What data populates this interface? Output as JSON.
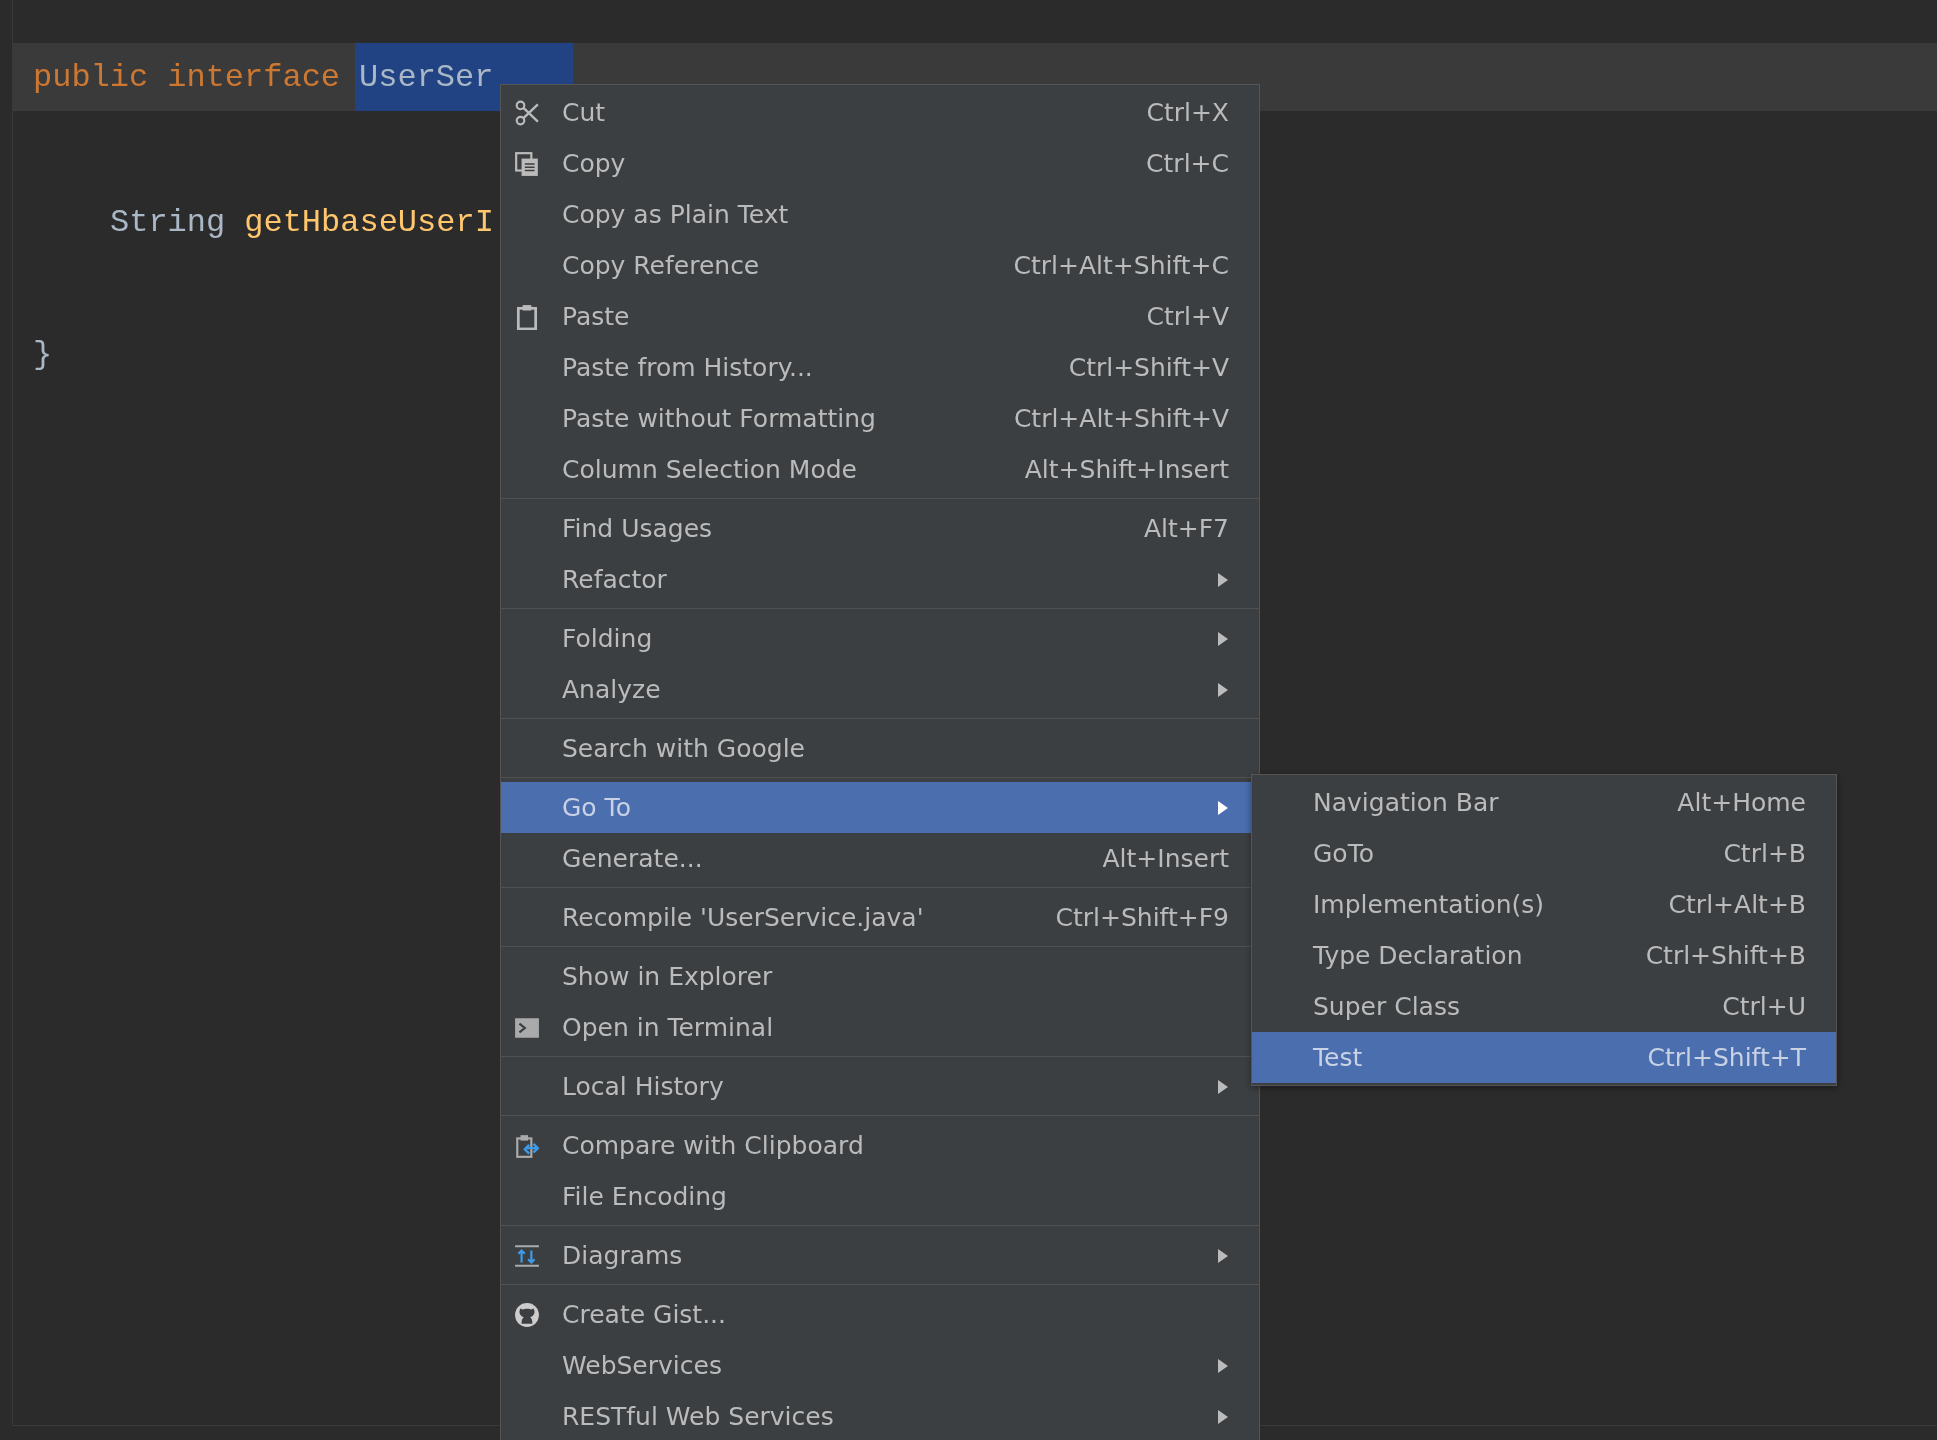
{
  "editor": {
    "lines": [
      {
        "current": true,
        "tokens": [
          {
            "text": "public",
            "kind": "keyword"
          },
          {
            "text": "interface",
            "kind": "keyword"
          },
          {
            "text": "UserSer",
            "kind": "plain",
            "selected": true
          }
        ],
        "children": [
          {
            "current": false,
            "tokens": [
              {
                "text": "String",
                "kind": "plain"
              },
              {
                "text": "getHbaseUserI",
                "kind": "method"
              }
            ]
          }
        ]
      },
      {
        "current": false,
        "tokens": [
          {
            "text": "}",
            "kind": "plain"
          }
        ]
      }
    ]
  },
  "context_menu": {
    "groups": [
      {
        "items": [
          {
            "label": "Cut",
            "shortcut": "Ctrl+X",
            "kind": "scissors",
            "selected": false
          },
          {
            "label": "Copy",
            "shortcut": "Ctrl+C",
            "kind": "copy",
            "selected": false
          },
          {
            "label": "Copy as Plain Text",
            "selected": false
          },
          {
            "label": "Copy Reference",
            "shortcut": "Ctrl+Alt+Shift+C",
            "selected": false
          },
          {
            "label": "Paste",
            "shortcut": "Ctrl+V",
            "kind": "clipboard",
            "selected": false
          },
          {
            "label": "Paste from History...",
            "shortcut": "Ctrl+Shift+V",
            "selected": false
          },
          {
            "label": "Paste without Formatting",
            "shortcut": "Ctrl+Alt+Shift+V",
            "selected": false
          },
          {
            "label": "Column Selection Mode",
            "shortcut": "Alt+Shift+Insert",
            "selected": false
          }
        ]
      },
      {
        "items": [
          {
            "label": "Find Usages",
            "shortcut": "Alt+F7",
            "selected": false
          },
          {
            "label": "Refactor",
            "has_submenu": true,
            "selected": false
          }
        ]
      },
      {
        "items": [
          {
            "label": "Folding",
            "has_submenu": true,
            "selected": false
          },
          {
            "label": "Analyze",
            "has_submenu": true,
            "selected": false
          }
        ]
      },
      {
        "items": [
          {
            "label": "Search with Google",
            "selected": false
          }
        ]
      },
      {
        "items": [
          {
            "label": "Go To",
            "has_submenu": true,
            "selected": true
          },
          {
            "label": "Generate...",
            "shortcut": "Alt+Insert",
            "selected": false
          }
        ]
      },
      {
        "items": [
          {
            "label": "Recompile 'UserService.java'",
            "shortcut": "Ctrl+Shift+F9",
            "selected": false
          }
        ]
      },
      {
        "items": [
          {
            "label": "Show in Explorer",
            "selected": false
          },
          {
            "label": "Open in Terminal",
            "kind": "terminal",
            "selected": false
          }
        ]
      },
      {
        "items": [
          {
            "label": "Local History",
            "has_submenu": true,
            "selected": false
          }
        ]
      },
      {
        "items": [
          {
            "label": "Compare with Clipboard",
            "kind": "compare",
            "selected": false
          },
          {
            "label": "File Encoding",
            "selected": false
          }
        ]
      },
      {
        "items": [
          {
            "label": "Diagrams",
            "kind": "diagram",
            "has_submenu": true,
            "selected": false
          }
        ]
      },
      {
        "items": [
          {
            "label": "Create Gist...",
            "kind": "cat",
            "selected": false
          },
          {
            "label": "WebServices",
            "has_submenu": true,
            "selected": false
          },
          {
            "label": "RESTful Web Services",
            "has_submenu": true,
            "selected": false
          }
        ]
      }
    ]
  },
  "submenu": {
    "items": [
      {
        "label": "Navigation Bar",
        "shortcut": "Alt+Home",
        "selected": false
      },
      {
        "label": "GoTo",
        "shortcut": "Ctrl+B",
        "selected": false
      },
      {
        "label": "Implementation(s)",
        "shortcut": "Ctrl+Alt+B",
        "selected": false
      },
      {
        "label": "Type Declaration",
        "shortcut": "Ctrl+Shift+B",
        "selected": false
      },
      {
        "label": "Super Class",
        "shortcut": "Ctrl+U",
        "selected": false
      },
      {
        "label": "Test",
        "shortcut": "Ctrl+Shift+T",
        "selected": true
      }
    ]
  }
}
